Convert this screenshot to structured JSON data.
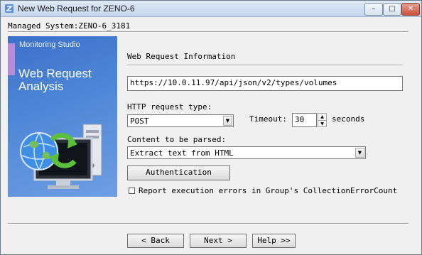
{
  "window": {
    "title": "New Web Request for ZENO-6",
    "minimize_glyph": "–",
    "maximize_glyph": "□",
    "close_glyph": "✕"
  },
  "header": {
    "managed_system": "Managed System:ZENO-6_3181"
  },
  "banner": {
    "brand": "Monitoring Studio",
    "title_line1": "Web Request",
    "title_line2": "Analysis",
    "icons": [
      "globe-icon",
      "refresh-arrows-icon",
      "monitor-icon",
      "server-tower-icon"
    ]
  },
  "form": {
    "section_title": "Web Request Information",
    "url_value": "https://10.0.11.97/api/json/v2/types/volumes",
    "http_type_label": "HTTP request type:",
    "http_type_value": "POST",
    "timeout_label": "Timeout:",
    "timeout_value": "30",
    "timeout_unit": "seconds",
    "content_label": "Content to be parsed:",
    "content_value": "Extract text from HTML",
    "auth_button": "Authentication",
    "report_errors_label": "Report execution errors in Group's CollectionErrorCount",
    "report_errors_checked": false
  },
  "footer": {
    "back_button": "< Back",
    "next_button": "Next >",
    "help_button": "Help >>"
  },
  "colors": {
    "banner_blue": "#4f88d8",
    "accent_purple": "#b88ad8",
    "title_bar": "#c4d6ec"
  }
}
